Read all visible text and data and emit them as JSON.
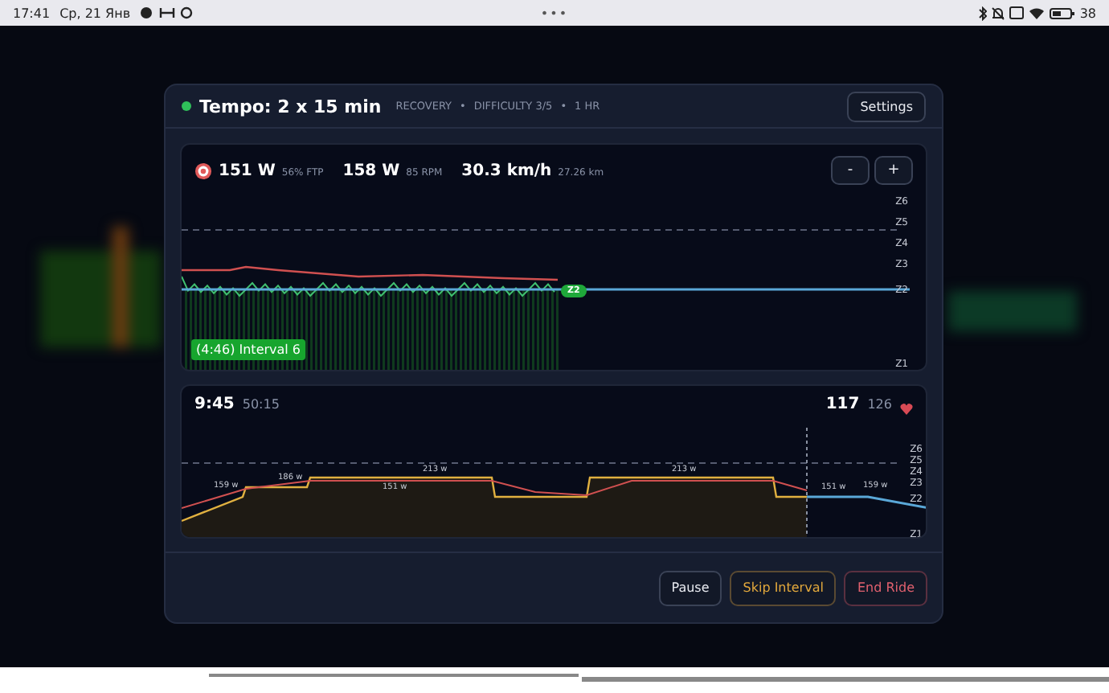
{
  "status_bar": {
    "time": "17:41",
    "date": "Ср, 21 Янв",
    "center": "•••",
    "battery": "38"
  },
  "modal": {
    "title": "Tempo: 2 x 15 min",
    "separator": "•",
    "tags": [
      "RECOVERY",
      "DIFFICULTY 3/5",
      "1 HR"
    ],
    "settings_button": "Settings"
  },
  "live_chart": {
    "stats": [
      {
        "kind": "target",
        "value": "151 W",
        "detail": "56% FTP"
      },
      {
        "kind": "plain",
        "value": "158 W",
        "detail": "85 RPM"
      },
      {
        "kind": "plain",
        "value": "30.3 km/h",
        "detail": "27.26 km"
      }
    ],
    "zoom_buttons": [
      "-",
      "+"
    ],
    "zone_labels": [
      "Z6",
      "Z5",
      "Z4",
      "Z3",
      "Z2",
      "Z1"
    ],
    "zone_badge": "Z2",
    "interval_label": "(4:46) Interval 6"
  },
  "workout_chart": {
    "elapsed": "9:45",
    "total": "50:15",
    "heart_rate": "117",
    "heart_rate_max": "126",
    "zone_labels": [
      "Z6",
      "Z5",
      "Z4",
      "Z3",
      "Z2",
      "Z1"
    ],
    "power_labels": [
      "159 w",
      "186 w",
      "213 w",
      "151 w",
      "213 w",
      "151 w",
      "159 w"
    ]
  },
  "buttons": [
    {
      "kind": "neutral",
      "label": "Pause"
    },
    {
      "kind": "warning",
      "label": "Skip Interval"
    },
    {
      "kind": "danger",
      "label": "End Ride"
    }
  ]
}
